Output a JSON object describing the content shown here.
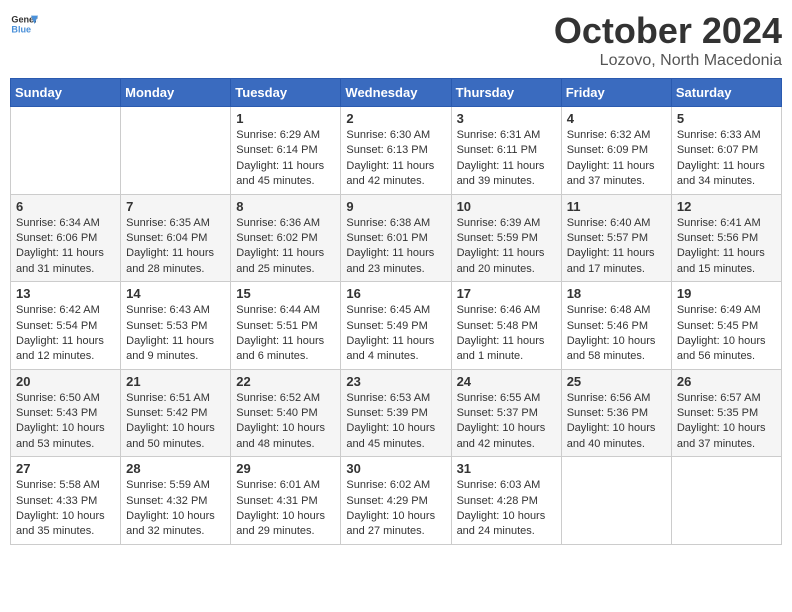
{
  "header": {
    "logo_general": "General",
    "logo_blue": "Blue",
    "month": "October 2024",
    "location": "Lozovo, North Macedonia"
  },
  "days_of_week": [
    "Sunday",
    "Monday",
    "Tuesday",
    "Wednesday",
    "Thursday",
    "Friday",
    "Saturday"
  ],
  "weeks": [
    [
      {
        "day": "",
        "info": ""
      },
      {
        "day": "",
        "info": ""
      },
      {
        "day": "1",
        "sunrise": "Sunrise: 6:29 AM",
        "sunset": "Sunset: 6:14 PM",
        "daylight": "Daylight: 11 hours and 45 minutes."
      },
      {
        "day": "2",
        "sunrise": "Sunrise: 6:30 AM",
        "sunset": "Sunset: 6:13 PM",
        "daylight": "Daylight: 11 hours and 42 minutes."
      },
      {
        "day": "3",
        "sunrise": "Sunrise: 6:31 AM",
        "sunset": "Sunset: 6:11 PM",
        "daylight": "Daylight: 11 hours and 39 minutes."
      },
      {
        "day": "4",
        "sunrise": "Sunrise: 6:32 AM",
        "sunset": "Sunset: 6:09 PM",
        "daylight": "Daylight: 11 hours and 37 minutes."
      },
      {
        "day": "5",
        "sunrise": "Sunrise: 6:33 AM",
        "sunset": "Sunset: 6:07 PM",
        "daylight": "Daylight: 11 hours and 34 minutes."
      }
    ],
    [
      {
        "day": "6",
        "sunrise": "Sunrise: 6:34 AM",
        "sunset": "Sunset: 6:06 PM",
        "daylight": "Daylight: 11 hours and 31 minutes."
      },
      {
        "day": "7",
        "sunrise": "Sunrise: 6:35 AM",
        "sunset": "Sunset: 6:04 PM",
        "daylight": "Daylight: 11 hours and 28 minutes."
      },
      {
        "day": "8",
        "sunrise": "Sunrise: 6:36 AM",
        "sunset": "Sunset: 6:02 PM",
        "daylight": "Daylight: 11 hours and 25 minutes."
      },
      {
        "day": "9",
        "sunrise": "Sunrise: 6:38 AM",
        "sunset": "Sunset: 6:01 PM",
        "daylight": "Daylight: 11 hours and 23 minutes."
      },
      {
        "day": "10",
        "sunrise": "Sunrise: 6:39 AM",
        "sunset": "Sunset: 5:59 PM",
        "daylight": "Daylight: 11 hours and 20 minutes."
      },
      {
        "day": "11",
        "sunrise": "Sunrise: 6:40 AM",
        "sunset": "Sunset: 5:57 PM",
        "daylight": "Daylight: 11 hours and 17 minutes."
      },
      {
        "day": "12",
        "sunrise": "Sunrise: 6:41 AM",
        "sunset": "Sunset: 5:56 PM",
        "daylight": "Daylight: 11 hours and 15 minutes."
      }
    ],
    [
      {
        "day": "13",
        "sunrise": "Sunrise: 6:42 AM",
        "sunset": "Sunset: 5:54 PM",
        "daylight": "Daylight: 11 hours and 12 minutes."
      },
      {
        "day": "14",
        "sunrise": "Sunrise: 6:43 AM",
        "sunset": "Sunset: 5:53 PM",
        "daylight": "Daylight: 11 hours and 9 minutes."
      },
      {
        "day": "15",
        "sunrise": "Sunrise: 6:44 AM",
        "sunset": "Sunset: 5:51 PM",
        "daylight": "Daylight: 11 hours and 6 minutes."
      },
      {
        "day": "16",
        "sunrise": "Sunrise: 6:45 AM",
        "sunset": "Sunset: 5:49 PM",
        "daylight": "Daylight: 11 hours and 4 minutes."
      },
      {
        "day": "17",
        "sunrise": "Sunrise: 6:46 AM",
        "sunset": "Sunset: 5:48 PM",
        "daylight": "Daylight: 11 hours and 1 minute."
      },
      {
        "day": "18",
        "sunrise": "Sunrise: 6:48 AM",
        "sunset": "Sunset: 5:46 PM",
        "daylight": "Daylight: 10 hours and 58 minutes."
      },
      {
        "day": "19",
        "sunrise": "Sunrise: 6:49 AM",
        "sunset": "Sunset: 5:45 PM",
        "daylight": "Daylight: 10 hours and 56 minutes."
      }
    ],
    [
      {
        "day": "20",
        "sunrise": "Sunrise: 6:50 AM",
        "sunset": "Sunset: 5:43 PM",
        "daylight": "Daylight: 10 hours and 53 minutes."
      },
      {
        "day": "21",
        "sunrise": "Sunrise: 6:51 AM",
        "sunset": "Sunset: 5:42 PM",
        "daylight": "Daylight: 10 hours and 50 minutes."
      },
      {
        "day": "22",
        "sunrise": "Sunrise: 6:52 AM",
        "sunset": "Sunset: 5:40 PM",
        "daylight": "Daylight: 10 hours and 48 minutes."
      },
      {
        "day": "23",
        "sunrise": "Sunrise: 6:53 AM",
        "sunset": "Sunset: 5:39 PM",
        "daylight": "Daylight: 10 hours and 45 minutes."
      },
      {
        "day": "24",
        "sunrise": "Sunrise: 6:55 AM",
        "sunset": "Sunset: 5:37 PM",
        "daylight": "Daylight: 10 hours and 42 minutes."
      },
      {
        "day": "25",
        "sunrise": "Sunrise: 6:56 AM",
        "sunset": "Sunset: 5:36 PM",
        "daylight": "Daylight: 10 hours and 40 minutes."
      },
      {
        "day": "26",
        "sunrise": "Sunrise: 6:57 AM",
        "sunset": "Sunset: 5:35 PM",
        "daylight": "Daylight: 10 hours and 37 minutes."
      }
    ],
    [
      {
        "day": "27",
        "sunrise": "Sunrise: 5:58 AM",
        "sunset": "Sunset: 4:33 PM",
        "daylight": "Daylight: 10 hours and 35 minutes."
      },
      {
        "day": "28",
        "sunrise": "Sunrise: 5:59 AM",
        "sunset": "Sunset: 4:32 PM",
        "daylight": "Daylight: 10 hours and 32 minutes."
      },
      {
        "day": "29",
        "sunrise": "Sunrise: 6:01 AM",
        "sunset": "Sunset: 4:31 PM",
        "daylight": "Daylight: 10 hours and 29 minutes."
      },
      {
        "day": "30",
        "sunrise": "Sunrise: 6:02 AM",
        "sunset": "Sunset: 4:29 PM",
        "daylight": "Daylight: 10 hours and 27 minutes."
      },
      {
        "day": "31",
        "sunrise": "Sunrise: 6:03 AM",
        "sunset": "Sunset: 4:28 PM",
        "daylight": "Daylight: 10 hours and 24 minutes."
      },
      {
        "day": "",
        "info": ""
      },
      {
        "day": "",
        "info": ""
      }
    ]
  ]
}
